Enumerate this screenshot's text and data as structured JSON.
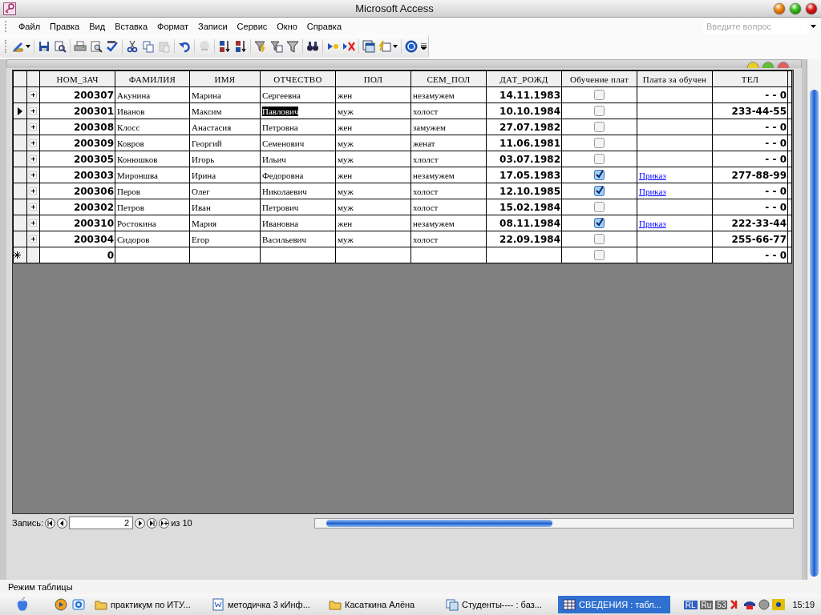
{
  "window": {
    "title": "Microsoft Access"
  },
  "menu": [
    "Файл",
    "Правка",
    "Вид",
    "Вставка",
    "Формат",
    "Записи",
    "Сервис",
    "Окно",
    "Справка"
  ],
  "search": {
    "placeholder": "Введите вопрос"
  },
  "table": {
    "columns": [
      "НОМ_ЗАЧ",
      "ФАМИЛИЯ",
      "ИМЯ",
      "ОТЧЕСТВО",
      "ПОЛ",
      "СЕМ_ПОЛ",
      "ДАТ_РОЖД",
      "Обучение плат",
      "Плата за обучен",
      "ТЕЛ"
    ],
    "rows": [
      {
        "selected": false,
        "text_selected": false,
        "num": "200307",
        "surname": "Акунина",
        "name": "Марина",
        "patronymic": "Сергеевна",
        "sex": "жен",
        "marital": "незамужем",
        "dob": "14.11.1983",
        "paid": false,
        "phone": "- - 0"
      },
      {
        "selected": true,
        "text_selected": true,
        "num": "200301",
        "surname": "Иванов",
        "name": "Максим",
        "patronymic": "Павлович",
        "sex": "муж",
        "marital": "холост",
        "dob": "10.10.1984",
        "paid": false,
        "phone": "233-44-55"
      },
      {
        "selected": false,
        "text_selected": false,
        "num": "200308",
        "surname": "Клосс",
        "name": "Анастасия",
        "patronymic": "Петровна",
        "sex": "жен",
        "marital": "замужем",
        "dob": "27.07.1982",
        "paid": false,
        "phone": "- - 0"
      },
      {
        "selected": false,
        "text_selected": false,
        "num": "200309",
        "surname": "Ковров",
        "name": "Георгий",
        "patronymic": "Семенович",
        "sex": "муж",
        "marital": "женат",
        "dob": "11.06.1981",
        "paid": false,
        "phone": "- - 0"
      },
      {
        "selected": false,
        "text_selected": false,
        "num": "200305",
        "surname": "Конюшков",
        "name": "Игорь",
        "patronymic": "Ильич",
        "sex": "муж",
        "marital": "хлолст",
        "dob": "03.07.1982",
        "paid": false,
        "phone": "- - 0"
      },
      {
        "selected": false,
        "text_selected": false,
        "num": "200303",
        "surname": "Мироншва",
        "name": "Ирина",
        "patronymic": "Федоровна",
        "sex": "жен",
        "marital": "незамужем",
        "dob": "17.05.1983",
        "paid": true,
        "order": "Приказ",
        "phone": "277-88-99"
      },
      {
        "selected": false,
        "text_selected": false,
        "num": "200306",
        "surname": "Перов",
        "name": "Олег",
        "patronymic": "Николаевич",
        "sex": "муж",
        "marital": "холост",
        "dob": "12.10.1985",
        "paid": true,
        "order": "Приказ",
        "phone": "- - 0"
      },
      {
        "selected": false,
        "text_selected": false,
        "num": "200302",
        "surname": "Петров",
        "name": "Иван",
        "patronymic": "Петрович",
        "sex": "муж",
        "marital": "холост",
        "dob": "15.02.1984",
        "paid": false,
        "phone": "- - 0"
      },
      {
        "selected": false,
        "text_selected": false,
        "num": "200310",
        "surname": "Ростокина",
        "name": "Мария",
        "patronymic": "Ивановна",
        "sex": "жен",
        "marital": "незамужем",
        "dob": "08.11.1984",
        "paid": true,
        "order": "Приказ",
        "phone": "222-33-44"
      },
      {
        "selected": false,
        "text_selected": false,
        "num": "200304",
        "surname": "Сидоров",
        "name": "Егор",
        "patronymic": "Васильевич",
        "sex": "муж",
        "marital": "холост",
        "dob": "22.09.1984",
        "paid": false,
        "phone": "255-66-77"
      }
    ],
    "new_row": {
      "num": "0",
      "paid": false,
      "phone": "- - 0"
    }
  },
  "navigation": {
    "label": "Запись:",
    "current": "2",
    "total": "из 10"
  },
  "status_bar": "Режим таблицы",
  "taskbar": {
    "items": [
      {
        "label": "практикум по ИТУ...",
        "kind": "folder",
        "selected": false
      },
      {
        "label": "методичка 3 кИнф...",
        "kind": "word",
        "selected": false
      },
      {
        "label": "Касаткина Алёна",
        "kind": "folder",
        "selected": false
      },
      {
        "label": "Студенты---- : баз...",
        "kind": "database",
        "selected": false
      },
      {
        "label": "СВЕДЕНИЯ : табл...",
        "kind": "table",
        "selected": true
      }
    ],
    "tray": [
      "RL",
      "Ru",
      "53"
    ],
    "clock": "15:19"
  }
}
